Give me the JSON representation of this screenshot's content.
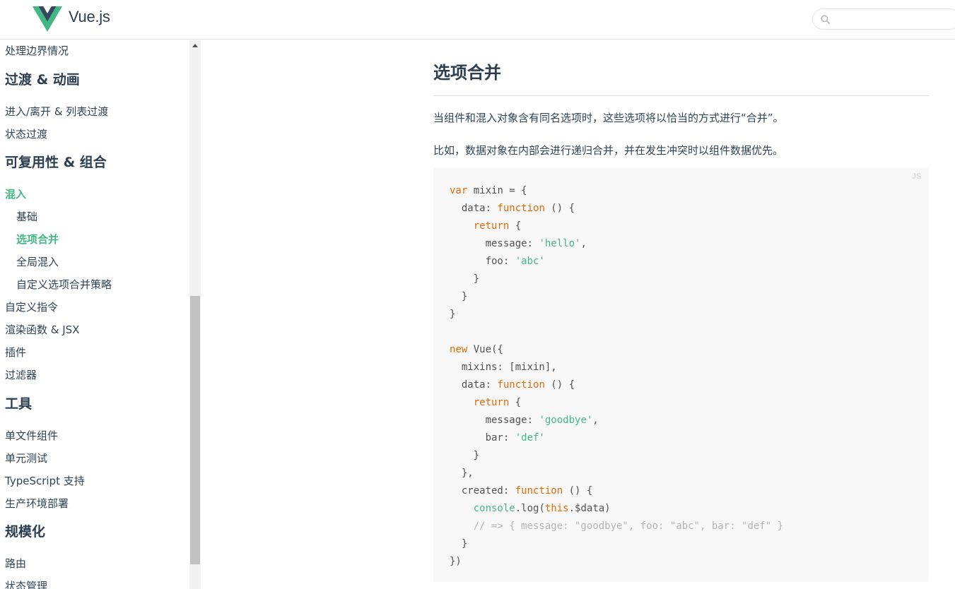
{
  "header": {
    "brand": "Vue.js",
    "search_placeholder": ""
  },
  "colors": {
    "accent": "#42b983",
    "text": "#2c3e50",
    "keyword": "#e96900",
    "string": "#42b983",
    "comment": "#b3b3b3"
  },
  "sidebar": {
    "items": [
      {
        "label": "处理边界情况",
        "level": "item"
      },
      {
        "label": "过渡 & 动画",
        "level": "heading"
      },
      {
        "label": "进入/离开 & 列表过渡",
        "level": "item"
      },
      {
        "label": "状态过渡",
        "level": "item"
      },
      {
        "label": "可复用性 & 组合",
        "level": "heading"
      },
      {
        "label": "混入",
        "level": "item",
        "active": true
      },
      {
        "label": "基础",
        "level": "sub"
      },
      {
        "label": "选项合并",
        "level": "sub",
        "active": true
      },
      {
        "label": "全局混入",
        "level": "sub"
      },
      {
        "label": "自定义选项合并策略",
        "level": "sub"
      },
      {
        "label": "自定义指令",
        "level": "item"
      },
      {
        "label": "渲染函数 & JSX",
        "level": "item"
      },
      {
        "label": "插件",
        "level": "item"
      },
      {
        "label": "过滤器",
        "level": "item"
      },
      {
        "label": "工具",
        "level": "heading"
      },
      {
        "label": "单文件组件",
        "level": "item"
      },
      {
        "label": "单元测试",
        "level": "item"
      },
      {
        "label": "TypeScript 支持",
        "level": "item"
      },
      {
        "label": "生产环境部署",
        "level": "item"
      },
      {
        "label": "规模化",
        "level": "heading"
      },
      {
        "label": "路由",
        "level": "item"
      },
      {
        "label": "状态管理",
        "level": "item"
      }
    ]
  },
  "main": {
    "title": "选项合并",
    "para1": "当组件和混入对象含有同名选项时，这些选项将以恰当的方式进行“合并”。",
    "para2": "比如，数据对象在内部会进行递归合并，并在发生冲突时以组件数据优先。",
    "code_lang": "JS",
    "code_lines": [
      [
        [
          "kw",
          "var"
        ],
        [
          "p",
          " mixin = {"
        ]
      ],
      [
        [
          "p",
          "  data: "
        ],
        [
          "kw",
          "function"
        ],
        [
          "p",
          " () {"
        ]
      ],
      [
        [
          "p",
          "    "
        ],
        [
          "kw",
          "return"
        ],
        [
          "p",
          " {"
        ]
      ],
      [
        [
          "p",
          "      message: "
        ],
        [
          "st",
          "'hello'"
        ],
        [
          "p",
          ","
        ]
      ],
      [
        [
          "p",
          "      foo: "
        ],
        [
          "st",
          "'abc'"
        ]
      ],
      [
        [
          "p",
          "    }"
        ]
      ],
      [
        [
          "p",
          "  }"
        ]
      ],
      [
        [
          "p",
          "}"
        ]
      ],
      [
        [
          "p",
          ""
        ]
      ],
      [
        [
          "kw",
          "new"
        ],
        [
          "p",
          " Vue({"
        ]
      ],
      [
        [
          "p",
          "  mixins: [mixin],"
        ]
      ],
      [
        [
          "p",
          "  data: "
        ],
        [
          "kw",
          "function"
        ],
        [
          "p",
          " () {"
        ]
      ],
      [
        [
          "p",
          "    "
        ],
        [
          "kw",
          "return"
        ],
        [
          "p",
          " {"
        ]
      ],
      [
        [
          "p",
          "      message: "
        ],
        [
          "st",
          "'goodbye'"
        ],
        [
          "p",
          ","
        ]
      ],
      [
        [
          "p",
          "      bar: "
        ],
        [
          "st",
          "'def'"
        ]
      ],
      [
        [
          "p",
          "    }"
        ]
      ],
      [
        [
          "p",
          "  },"
        ]
      ],
      [
        [
          "p",
          "  created: "
        ],
        [
          "kw",
          "function"
        ],
        [
          "p",
          " () {"
        ]
      ],
      [
        [
          "p",
          "    "
        ],
        [
          "st",
          "console"
        ],
        [
          "p",
          ".log("
        ],
        [
          "kw",
          "this"
        ],
        [
          "p",
          ".$data)"
        ]
      ],
      [
        [
          "p",
          "    "
        ],
        [
          "cm",
          "// => { message: \"goodbye\", foo: \"abc\", bar: \"def\" }"
        ]
      ],
      [
        [
          "p",
          "  }"
        ]
      ],
      [
        [
          "p",
          "})"
        ]
      ]
    ]
  }
}
